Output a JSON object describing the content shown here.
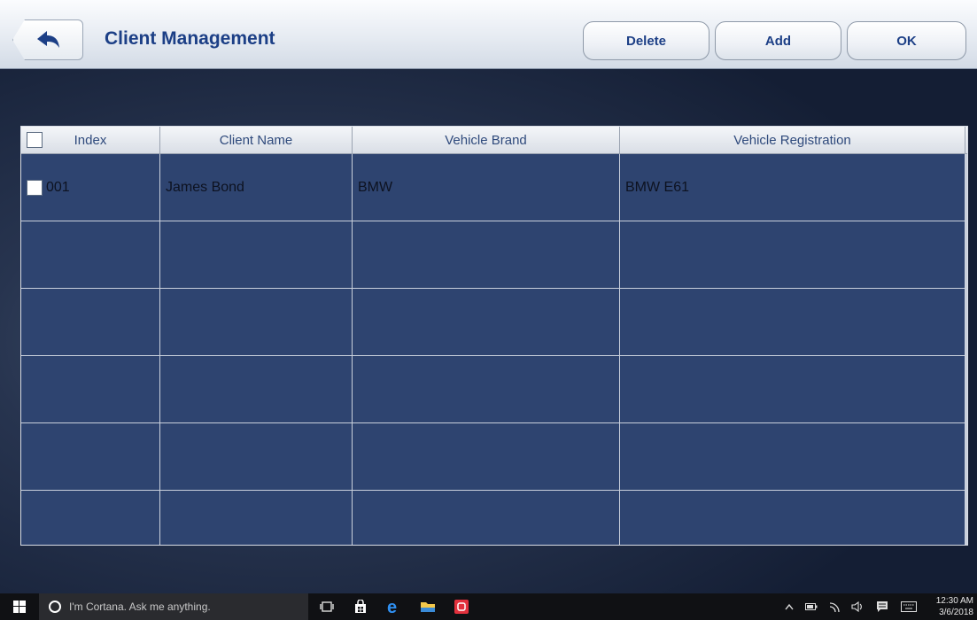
{
  "header": {
    "title": "Client Management",
    "buttons": {
      "delete": "Delete",
      "add": "Add",
      "ok": "OK"
    }
  },
  "table": {
    "columns": [
      "Index",
      "Client Name",
      "Vehicle Brand",
      "Vehicle Registration"
    ],
    "rows": [
      {
        "index": "001",
        "client_name": "James Bond",
        "vehicle_brand": "BMW",
        "vehicle_registration": "BMW E61"
      },
      {
        "index": "",
        "client_name": "",
        "vehicle_brand": "",
        "vehicle_registration": ""
      },
      {
        "index": "",
        "client_name": "",
        "vehicle_brand": "",
        "vehicle_registration": ""
      },
      {
        "index": "",
        "client_name": "",
        "vehicle_brand": "",
        "vehicle_registration": ""
      },
      {
        "index": "",
        "client_name": "",
        "vehicle_brand": "",
        "vehicle_registration": ""
      },
      {
        "index": "",
        "client_name": "",
        "vehicle_brand": "",
        "vehicle_registration": ""
      }
    ]
  },
  "taskbar": {
    "cortana_placeholder": "I'm Cortana. Ask me anything.",
    "time": "12:30 AM",
    "date": "3/6/2018"
  }
}
